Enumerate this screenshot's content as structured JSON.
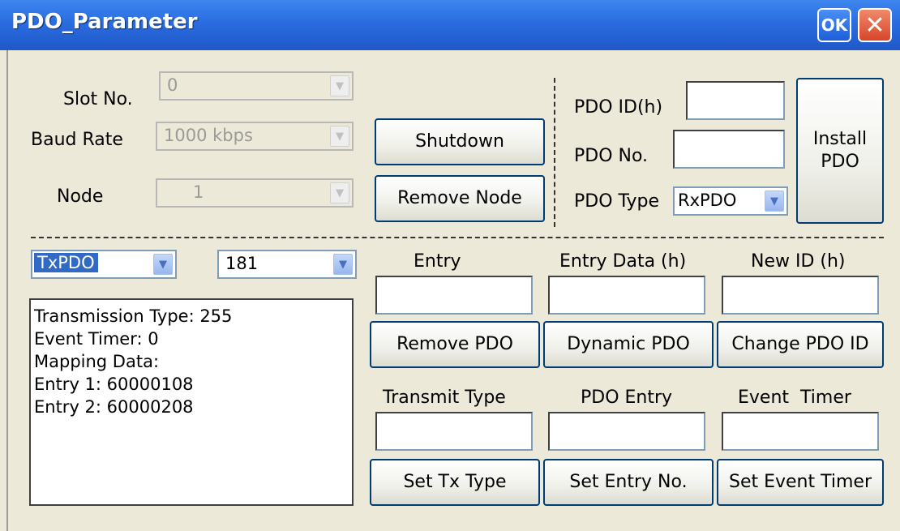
{
  "window": {
    "title": "PDO_Parameter",
    "ok_label": "OK",
    "close_glyph": "✕"
  },
  "fields": {
    "slot_label": "Slot No.",
    "slot_value": "0",
    "baud_label": "Baud Rate",
    "baud_value": "1000 kbps",
    "node_label": "Node",
    "node_value": "1",
    "pdo_id_label": "PDO ID(h)",
    "pdo_no_label": "PDO No.",
    "pdo_type_label": "PDO Type",
    "pdo_type_value": "RxPDO"
  },
  "buttons": {
    "shutdown": "Shutdown",
    "remove_node": "Remove Node",
    "install_line1": "Install",
    "install_line2": "PDO",
    "remove_pdo": "Remove PDO",
    "dynamic_pdo": "Dynamic PDO",
    "change_pdo_id": "Change PDO ID",
    "set_tx_type": "Set Tx Type",
    "set_entry_no": "Set Entry No.",
    "set_event_timer": "Set Event Timer"
  },
  "lower": {
    "pdo_kind_value": "TxPDO",
    "pdo_id_value": "181",
    "entry_label": "Entry",
    "entry_data_label": "Entry Data (h)",
    "new_id_label": "New ID (h)",
    "transmit_type_label": "Transmit Type",
    "pdo_entry_label": "PDO Entry",
    "event_timer_label": "Event  Timer"
  },
  "info_lines": [
    "Transmission Type: 255",
    "Event Timer: 0",
    "Mapping Data:",
    "Entry 1: 60000108",
    "Entry 2: 60000208"
  ],
  "icons": {
    "dropdown": "chevron-down-icon"
  }
}
